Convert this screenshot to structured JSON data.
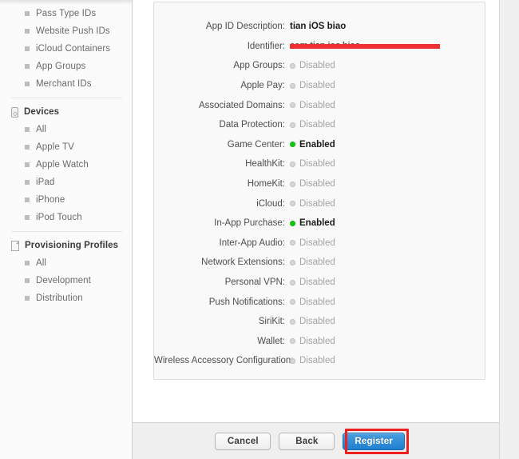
{
  "sidebar": {
    "groups": [
      {
        "header": null,
        "icon": null,
        "items": [
          {
            "label": "Pass Type IDs"
          },
          {
            "label": "Website Push IDs"
          },
          {
            "label": "iCloud Containers"
          },
          {
            "label": "App Groups"
          },
          {
            "label": "Merchant IDs"
          }
        ]
      },
      {
        "header": "Devices",
        "icon": "device-icon",
        "items": [
          {
            "label": "All"
          },
          {
            "label": "Apple TV"
          },
          {
            "label": "Apple Watch"
          },
          {
            "label": "iPad"
          },
          {
            "label": "iPhone"
          },
          {
            "label": "iPod Touch"
          }
        ]
      },
      {
        "header": "Provisioning Profiles",
        "icon": "document-icon",
        "items": [
          {
            "label": "All"
          },
          {
            "label": "Development"
          },
          {
            "label": "Distribution"
          }
        ]
      }
    ]
  },
  "summary": {
    "app_id_description": {
      "label": "App ID Description:",
      "value": "tian iOS biao"
    },
    "identifier": {
      "label": "Identifier:",
      "value": "com.tian.ios.biao",
      "redacted": true
    },
    "capabilities": [
      {
        "label": "App Groups:",
        "state": "Disabled"
      },
      {
        "label": "Apple Pay:",
        "state": "Disabled"
      },
      {
        "label": "Associated Domains:",
        "state": "Disabled"
      },
      {
        "label": "Data Protection:",
        "state": "Disabled"
      },
      {
        "label": "Game Center:",
        "state": "Enabled"
      },
      {
        "label": "HealthKit:",
        "state": "Disabled"
      },
      {
        "label": "HomeKit:",
        "state": "Disabled"
      },
      {
        "label": "iCloud:",
        "state": "Disabled"
      },
      {
        "label": "In-App Purchase:",
        "state": "Enabled"
      },
      {
        "label": "Inter-App Audio:",
        "state": "Disabled"
      },
      {
        "label": "Network Extensions:",
        "state": "Disabled"
      },
      {
        "label": "Personal VPN:",
        "state": "Disabled"
      },
      {
        "label": "Push Notifications:",
        "state": "Disabled"
      },
      {
        "label": "SiriKit:",
        "state": "Disabled"
      },
      {
        "label": "Wallet:",
        "state": "Disabled"
      },
      {
        "label": "Wireless Accessory Configuration:",
        "state": "Disabled"
      }
    ]
  },
  "footer": {
    "cancel_label": "Cancel",
    "back_label": "Back",
    "register_label": "Register"
  },
  "colors": {
    "enabled_dot": "#12c512",
    "disabled_dot": "#d6d6d6",
    "primary_button": "#1f7fd0",
    "highlight": "#ef2020",
    "redaction": "#f03030"
  }
}
